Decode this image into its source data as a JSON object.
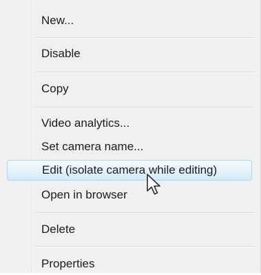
{
  "context_menu": {
    "items": [
      {
        "label": "New..."
      },
      {
        "label": "Disable"
      },
      {
        "label": "Copy"
      },
      {
        "label": "Video analytics..."
      },
      {
        "label": "Set camera name..."
      },
      {
        "label": "Edit (isolate camera while editing)",
        "highlighted": true
      },
      {
        "label": "Open in browser"
      },
      {
        "label": "Delete"
      },
      {
        "label": "Properties"
      }
    ]
  },
  "cursor_icon": "arrow-cursor-icon",
  "colors": {
    "menu_background": "#f0f0f0",
    "highlight_border": "#a8d8eb",
    "highlight_fill": "#e5f3fb",
    "separator": "#d7d7d7",
    "text": "#1c1c1c"
  }
}
